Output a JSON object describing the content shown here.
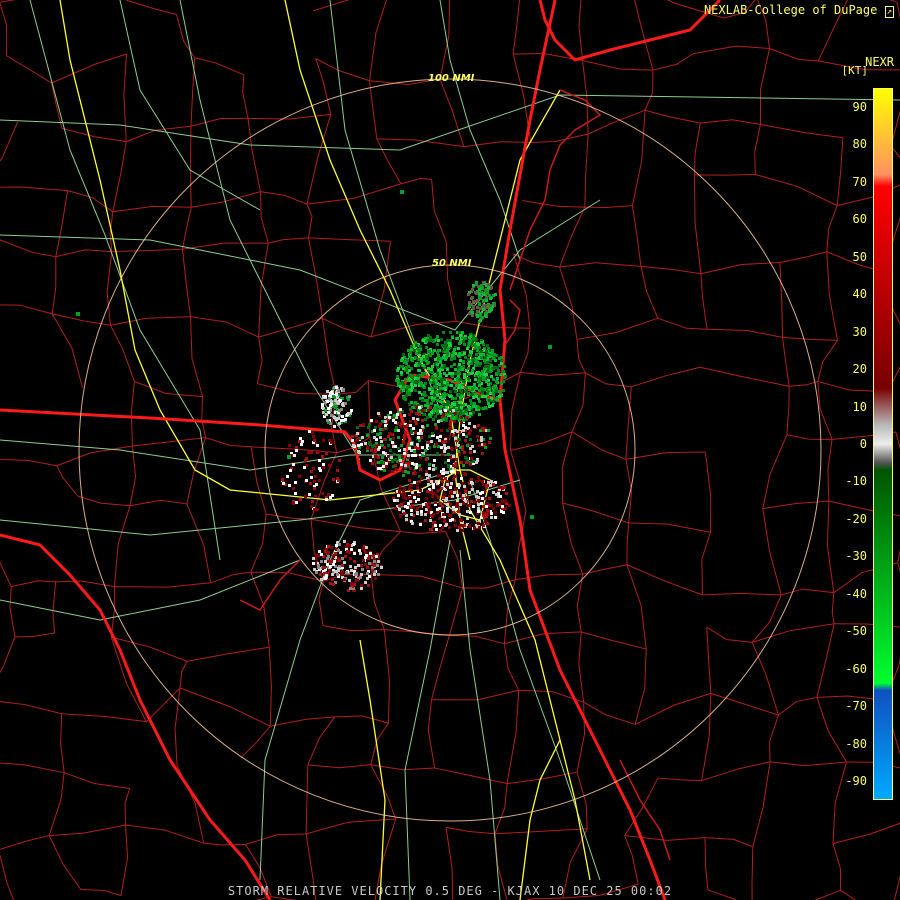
{
  "header": {
    "credit": "NEXLAB-College of DuPage",
    "product": "NEXR",
    "units": "[KT]"
  },
  "footer": {
    "caption": "STORM RELATIVE VELOCITY 0.5 DEG - KJAX 10 DEC 25 00:02"
  },
  "rings": [
    {
      "label": "100 NMI"
    },
    {
      "label": "50 NMI"
    }
  ],
  "colors": {
    "state_border": "#ff1a1a",
    "county_border": "#b21f1f",
    "highway": "#ffff33",
    "road": "#9be69b",
    "ring": "#ffcc99",
    "background": "#000000"
  },
  "color_scale": {
    "unit": "KT",
    "ticks": [
      "90",
      "80",
      "70",
      "60",
      "50",
      "40",
      "30",
      "20",
      "10",
      "0",
      "-10",
      "-20",
      "-30",
      "-40",
      "-50",
      "-60",
      "-70",
      "-80",
      "-90"
    ],
    "stops": [
      {
        "value": 95,
        "color": "#ffff00"
      },
      {
        "value": 72,
        "color": "#ff9060"
      },
      {
        "value": 69,
        "color": "#ff0000"
      },
      {
        "value": 15,
        "color": "#780000"
      },
      {
        "value": 5,
        "color": "#bbbbbb"
      },
      {
        "value": 0,
        "color": "#eeeeee"
      },
      {
        "value": -5,
        "color": "#555555"
      },
      {
        "value": -7,
        "color": "#005500"
      },
      {
        "value": -64,
        "color": "#00ff30"
      },
      {
        "value": -66,
        "color": "#1050c0"
      },
      {
        "value": -95,
        "color": "#00aaff"
      }
    ]
  }
}
